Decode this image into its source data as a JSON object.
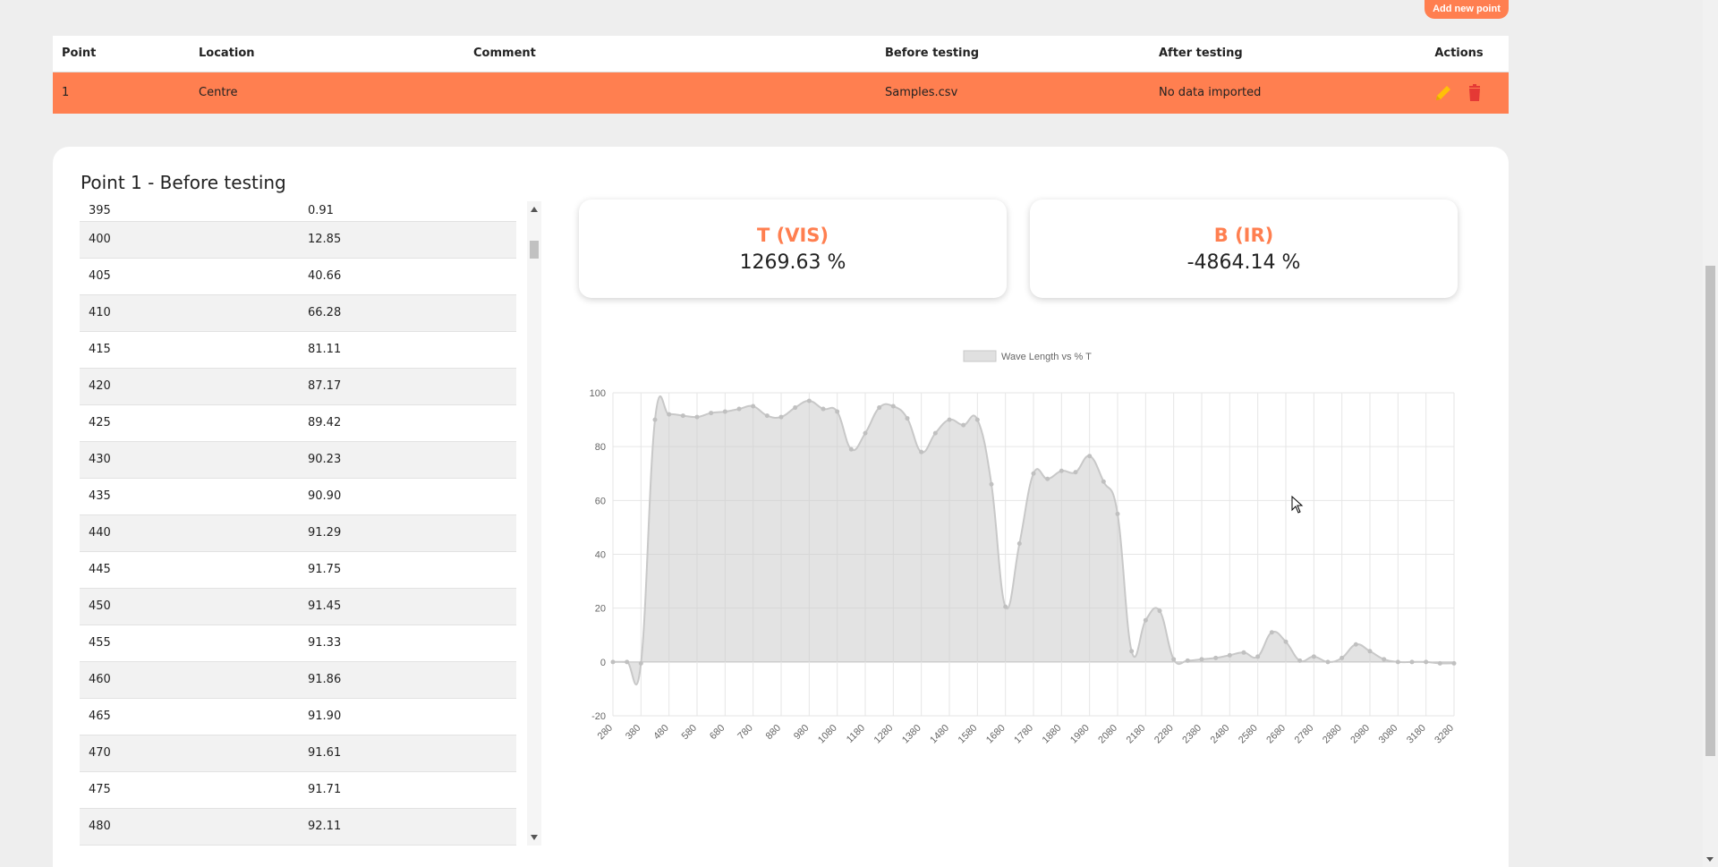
{
  "header": {
    "add_button_label": "Add new point"
  },
  "points_table": {
    "columns": [
      "Point",
      "Location",
      "Comment",
      "Before testing",
      "After testing",
      "Actions"
    ],
    "rows": [
      {
        "point": "1",
        "location": "Centre",
        "comment": "",
        "before": "Samples.csv",
        "after": "No data imported"
      }
    ]
  },
  "detail": {
    "title": "Point 1 - Before testing",
    "data_rows": [
      [
        "395",
        "0.91"
      ],
      [
        "400",
        "12.85"
      ],
      [
        "405",
        "40.66"
      ],
      [
        "410",
        "66.28"
      ],
      [
        "415",
        "81.11"
      ],
      [
        "420",
        "87.17"
      ],
      [
        "425",
        "89.42"
      ],
      [
        "430",
        "90.23"
      ],
      [
        "435",
        "90.90"
      ],
      [
        "440",
        "91.29"
      ],
      [
        "445",
        "91.75"
      ],
      [
        "450",
        "91.45"
      ],
      [
        "455",
        "91.33"
      ],
      [
        "460",
        "91.86"
      ],
      [
        "465",
        "91.90"
      ],
      [
        "470",
        "91.61"
      ],
      [
        "475",
        "91.71"
      ],
      [
        "480",
        "92.11"
      ]
    ],
    "stats": [
      {
        "label": "T (VIS)",
        "value": "1269.63 %"
      },
      {
        "label": "B (IR)",
        "value": "-4864.14 %"
      }
    ]
  },
  "colors": {
    "accent": "#ff7f50",
    "edit_icon": "#ffc107",
    "delete_icon": "#e53935"
  },
  "icons": {
    "edit": "pencil-icon",
    "delete": "trash-icon"
  },
  "chart_data": {
    "type": "area",
    "title": "",
    "legend": [
      "Wave Length vs % T"
    ],
    "legend_position": "top",
    "xlabel": "",
    "ylabel": "",
    "ylim": [
      -20,
      100
    ],
    "y_ticks": [
      "100",
      "80",
      "60",
      "40",
      "20",
      "0",
      "-20"
    ],
    "x_tick_labels": [
      "280",
      "380",
      "480",
      "580",
      "680",
      "780",
      "880",
      "980",
      "1080",
      "1180",
      "1280",
      "1380",
      "1480",
      "1580",
      "1680",
      "1780",
      "1880",
      "1980",
      "2080",
      "2180",
      "2280",
      "2380",
      "2480",
      "2580",
      "2680",
      "2780",
      "2880",
      "2980",
      "3080",
      "3180",
      "3280"
    ],
    "grid": true,
    "series": [
      {
        "name": "Wave Length vs % T",
        "x": [
          280,
          330,
          380,
          430,
          480,
          530,
          580,
          630,
          680,
          730,
          780,
          830,
          880,
          930,
          980,
          1030,
          1080,
          1130,
          1180,
          1230,
          1280,
          1330,
          1380,
          1430,
          1480,
          1530,
          1580,
          1630,
          1680,
          1730,
          1780,
          1830,
          1880,
          1930,
          1980,
          2030,
          2080,
          2130,
          2180,
          2230,
          2280,
          2330,
          2380,
          2430,
          2480,
          2530,
          2580,
          2630,
          2680,
          2730,
          2780,
          2830,
          2880,
          2930,
          2980,
          3030,
          3080,
          3130,
          3180,
          3230,
          3280
        ],
        "values": [
          0,
          0,
          -0.5,
          90,
          92,
          91.5,
          91,
          92.5,
          93,
          94,
          95,
          91.5,
          91,
          94.5,
          97,
          94,
          93,
          79,
          85,
          94.5,
          95,
          90.5,
          78,
          85,
          90,
          88,
          90,
          66,
          20.5,
          44,
          70,
          68,
          71,
          70.5,
          76.5,
          67,
          55,
          4,
          15.5,
          19,
          1,
          0.5,
          1,
          1.5,
          2.5,
          3.5,
          2,
          11,
          7.5,
          0.5,
          2,
          0,
          1.5,
          6.5,
          4,
          1,
          0,
          0,
          0,
          -0.5,
          -0.5
        ]
      }
    ]
  }
}
